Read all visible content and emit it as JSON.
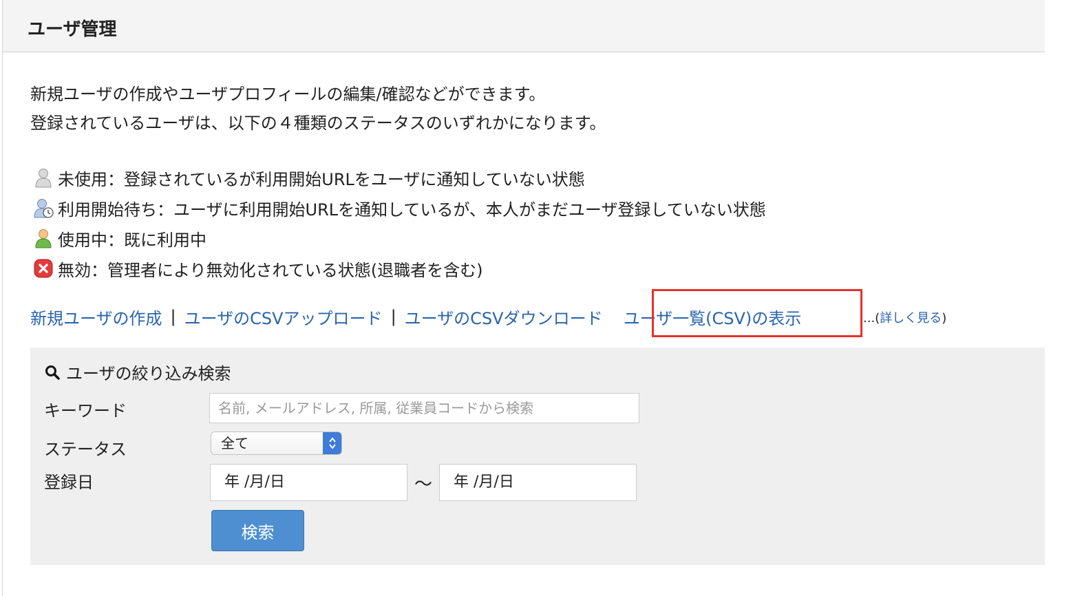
{
  "header": {
    "title": "ユーザ管理"
  },
  "description": {
    "line1": "新規ユーザの作成やユーザプロフィールの編集/確認などができます。",
    "line2": "登録されているユーザは、以下の４種類のステータスのいずれかになります。"
  },
  "statuses": [
    {
      "icon": "gray-user-icon",
      "text": "未使用：登録されているが利用開始URLをユーザに通知していない状態"
    },
    {
      "icon": "clock-user-icon",
      "text": "利用開始待ち：ユーザに利用開始URLを通知しているが、本人がまだユーザ登録していない状態"
    },
    {
      "icon": "green-user-icon",
      "text": "使用中：既に利用中"
    },
    {
      "icon": "red-x-icon",
      "text": "無効：管理者により無効化されている状態(退職者を含む)"
    }
  ],
  "links": {
    "create_user": "新規ユーザの作成",
    "separator": "|",
    "csv_upload": "ユーザのCSVアップロード",
    "csv_download": "ユーザのCSVダウンロード",
    "csv_view": "ユーザ一覧(CSV)の表示",
    "more_prefix": "...(",
    "more_link": "詳しく見る",
    "more_suffix": ")"
  },
  "search": {
    "title": "ユーザの絞り込み検索",
    "keyword_label": "キーワード",
    "keyword_placeholder": "名前, メールアドレス, 所属, 従業員コードから検索",
    "status_label": "ステータス",
    "status_selected": "全て",
    "date_label": "登録日",
    "date_from": "年 /月/日",
    "date_to": "年 /月/日",
    "tilde": "〜",
    "button_label": "検索"
  },
  "colors": {
    "link": "#2a64ad",
    "highlight": "#e8302b",
    "button": "#4d8fd0"
  }
}
